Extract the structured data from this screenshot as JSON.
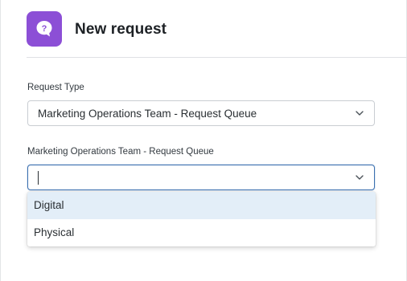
{
  "header": {
    "title": "New request",
    "icon": "question-bubble-icon",
    "icon_glyph": "?",
    "icon_color": "#8c4fd6"
  },
  "request_type": {
    "label": "Request Type",
    "selected_value": "Marketing Operations Team - Request Queue"
  },
  "queue_field": {
    "label": "Marketing Operations Team - Request Queue",
    "value": ""
  },
  "dropdown": {
    "options": [
      {
        "label": "Digital",
        "highlighted": true
      },
      {
        "label": "Physical",
        "highlighted": false
      }
    ]
  },
  "colors": {
    "accent": "#3b6fb0",
    "highlight": "#e3eef8"
  }
}
